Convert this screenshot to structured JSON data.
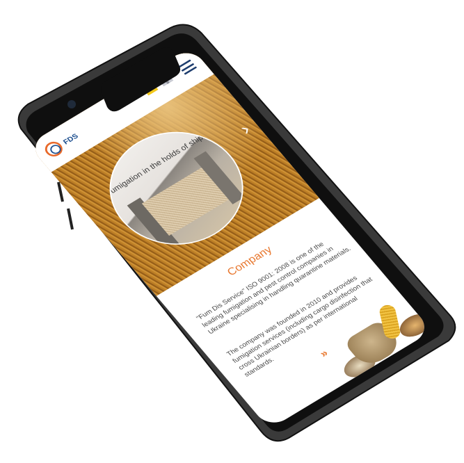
{
  "header": {
    "logo_text": "FDS",
    "flags": [
      "ukraine-flag",
      "uk-flag"
    ],
    "menu_icon": "hamburger-menu-icon"
  },
  "hero": {
    "slide_caption": "Fumigation in the holds of ships",
    "next_arrow": "›"
  },
  "company": {
    "title": "Company",
    "paragraph_1": "\"Fum Dis Service\" ISO 9001: 2008 is one of the leading fumigation and pest control companies in Ukraine specialising in handling quarantine materials.",
    "paragraph_2": "The company was founded in 2010 and provides fumigation services (including cargo disinfection that cross Ukrainian borders) as per international standards.",
    "more_icon": "»"
  },
  "colors": {
    "accent": "#e8772e",
    "brand_blue": "#1d4f8f",
    "phone_body": "#1a1a1a"
  }
}
